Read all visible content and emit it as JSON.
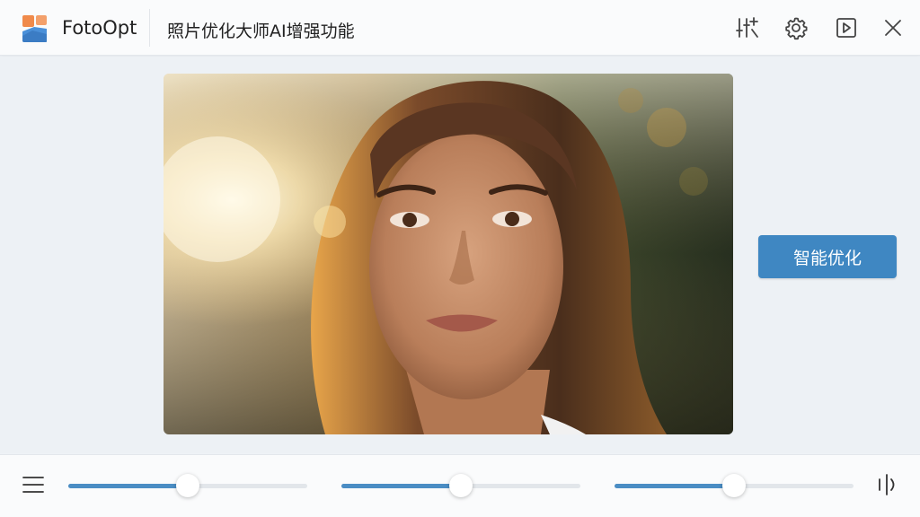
{
  "header": {
    "app_name": "FotoOpt",
    "title": "照片优化大师AI增强功能",
    "icons": [
      "adjust-icon",
      "gear-icon",
      "play-icon",
      "close-icon"
    ]
  },
  "main": {
    "enhance_button": "智能优化"
  },
  "bottom": {
    "sliders": [
      {
        "name": "slider-1",
        "value": 0.5
      },
      {
        "name": "slider-2",
        "value": 0.5
      },
      {
        "name": "slider-3",
        "value": 0.5
      }
    ]
  },
  "colors": {
    "accent": "#3f87c2",
    "logo_orange": "#f08a4b",
    "logo_blue": "#4a90d9"
  }
}
